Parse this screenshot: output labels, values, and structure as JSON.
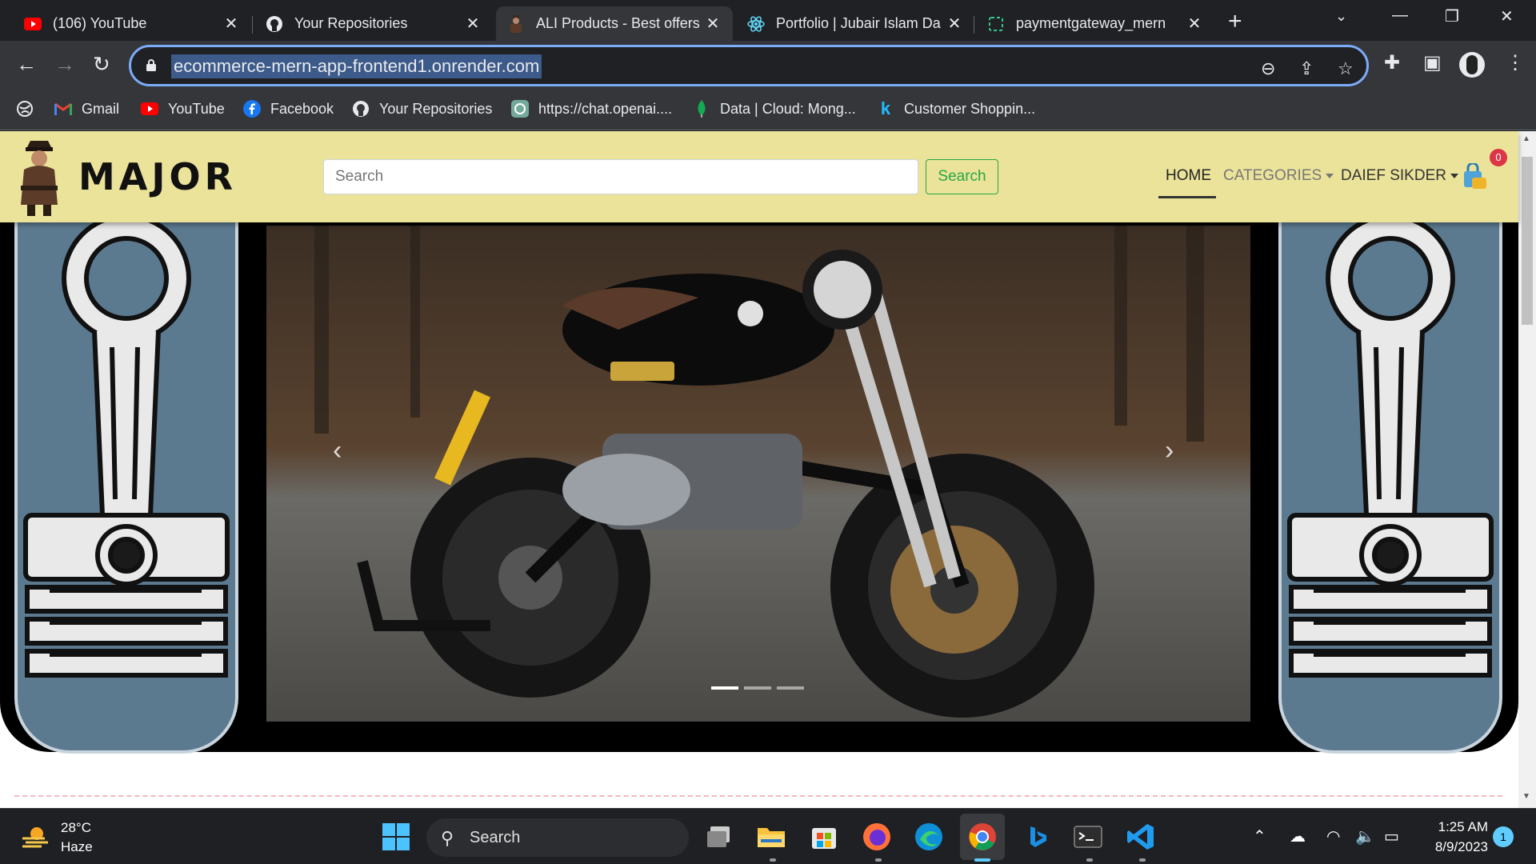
{
  "browser": {
    "tabs": [
      {
        "title": "(106) YouTube",
        "icon": "youtube-icon"
      },
      {
        "title": "Your Repositories",
        "icon": "github-icon"
      },
      {
        "title": "ALI Products - Best offers",
        "icon": "site-favicon",
        "active": true
      },
      {
        "title": "Portfolio | Jubair Islam Da",
        "icon": "react-icon"
      },
      {
        "title": "paymentgateway_mern",
        "icon": "loading-icon"
      }
    ],
    "url": "ecommerce-mern-app-frontend1.onrender.com",
    "bookmarks": [
      {
        "label": "Gmail",
        "icon": "gmail-icon"
      },
      {
        "label": "YouTube",
        "icon": "youtube-icon"
      },
      {
        "label": "Facebook",
        "icon": "facebook-icon"
      },
      {
        "label": "Your Repositories",
        "icon": "github-icon"
      },
      {
        "label": "https://chat.openai....",
        "icon": "openai-icon"
      },
      {
        "label": "Data | Cloud: Mong...",
        "icon": "mongodb-icon"
      },
      {
        "label": "Customer Shoppin...",
        "icon": "kaggle-icon"
      }
    ]
  },
  "site": {
    "brand": "MAJOR",
    "search": {
      "placeholder": "Search",
      "button": "Search"
    },
    "nav": {
      "home": "HOME",
      "categories": "CATEGORIES",
      "user": "DAIEF SIKDER",
      "cart_count": "0"
    },
    "carousel": {
      "slide_count": 3,
      "active_index": 0
    },
    "colors": {
      "header_bg": "#ebe39a",
      "accent_green": "#28a745",
      "badge_red": "#dc3545",
      "piston_blue": "#5b7a90"
    }
  },
  "taskbar": {
    "weather": {
      "temp": "28°C",
      "condition": "Haze"
    },
    "search_label": "Search",
    "time": "1:25 AM",
    "date": "8/9/2023",
    "notifications": "1"
  }
}
